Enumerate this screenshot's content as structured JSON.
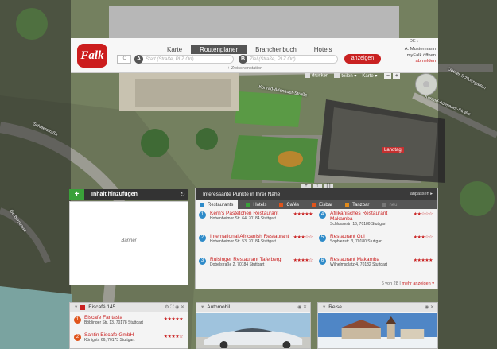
{
  "header": {
    "logo": "Falk",
    "tabs": [
      {
        "label": "Karte",
        "active": false
      },
      {
        "label": "Routenplaner",
        "active": true
      },
      {
        "label": "Branchenbuch",
        "active": false
      },
      {
        "label": "Hotels",
        "active": false
      }
    ],
    "io_label": "IO",
    "start_badge": "A",
    "start_placeholder": "Start (Straße, PLZ Ort)",
    "ziel_badge": "B",
    "ziel_placeholder": "Ziel (Straße, PLZ Ort)",
    "go_label": "anzeigen",
    "zwischen_label": "+ Zwischenstation",
    "lang": "DE ▸",
    "user_name": "A. Mustermann",
    "user_myfalk": "myFalk öffnen",
    "user_logout": "abmelden"
  },
  "map_tools": {
    "print": "drucken",
    "share": "teilen ▾",
    "map_type": "Karte ▾",
    "zoom_out": "−",
    "zoom_in": "+"
  },
  "map_labels": {
    "street1": "Konrad-Adenauer-Straße",
    "street2": "Konrad-Adenauer-Straße",
    "street3": "Charlottenplatz",
    "street4": "Oberer Schlossgarten",
    "street5": "Schillerstraße",
    "street6": "Gerberstraße",
    "landtag": "Landtag",
    "nav_left": "+",
    "nav_up": "↑",
    "nav_fit": "[ ]"
  },
  "sidebar": {
    "add_label": "Inhalt hinzufügen",
    "add_icon": "+",
    "refresh_icon": "↻",
    "banner": "Banner"
  },
  "poi": {
    "title": "Interessante Punkte in Ihrer Nähe",
    "anpassen": "anpassen ▸",
    "categories": [
      {
        "label": "Restaurants",
        "color": "#2e8bc9",
        "active": true
      },
      {
        "label": "Hotels",
        "color": "#3aa13a",
        "active": false
      },
      {
        "label": "Cafés",
        "color": "#e0541b",
        "active": false
      },
      {
        "label": "Eisbar",
        "color": "#e0541b",
        "active": false
      },
      {
        "label": "Tanzbar",
        "color": "#e08a1b",
        "active": false
      },
      {
        "label": "neu",
        "color": "#777777",
        "active": false
      }
    ],
    "items": [
      {
        "num": "1",
        "name": "Kern's Pastetchen Restaurant",
        "addr": "Hohenheimer Str. 64, 70184 Stuttgart",
        "stars": "★★★★★"
      },
      {
        "num": "4",
        "name": "Afrikanisches Restaurant Makamba",
        "addr": "Schlossestr. 16, 70180 Stuttgart",
        "stars": "★★☆☆☆"
      },
      {
        "num": "2",
        "name": "International Africanish Restaurant",
        "addr": "Hohenheimer Str. 53, 70184 Stuttgart",
        "stars": "★★★☆☆"
      },
      {
        "num": "5",
        "name": "Restaurant Gui",
        "addr": "Sophienstr. 3, 70180 Stuttgart",
        "stars": "★★★☆☆"
      },
      {
        "num": "3",
        "name": "Ruisinger Restaurant Tafelberg",
        "addr": "Dobelstraße 2, 70184 Stuttgart",
        "stars": "★★★★☆"
      },
      {
        "num": "6",
        "name": "Restaurant Makamba",
        "addr": "Wilhelmsplatz 4, 70182 Stuttgart",
        "stars": "★★★★★"
      }
    ],
    "count": "6 von 28",
    "more": "mehr anzeigen ▾"
  },
  "panels": {
    "cafe": {
      "title": "Eiscafé",
      "count": "145",
      "controls": "⚙ ⛶ ◉ ✕",
      "items": [
        {
          "num": "1",
          "name": "Eiscafe Fantasia",
          "addr": "Böblinger Str. 13, 70178 Stuttgart",
          "stars": "★★★★★"
        },
        {
          "num": "2",
          "name": "Santin Eiscafe GmbH",
          "addr": "Königstr. 66, 70173 Stuttgart",
          "stars": "★★★★☆"
        }
      ]
    },
    "auto": {
      "title": "Automobil",
      "controls": "◉ ✕"
    },
    "reise": {
      "title": "Reise",
      "controls": "◉ ✕"
    }
  }
}
